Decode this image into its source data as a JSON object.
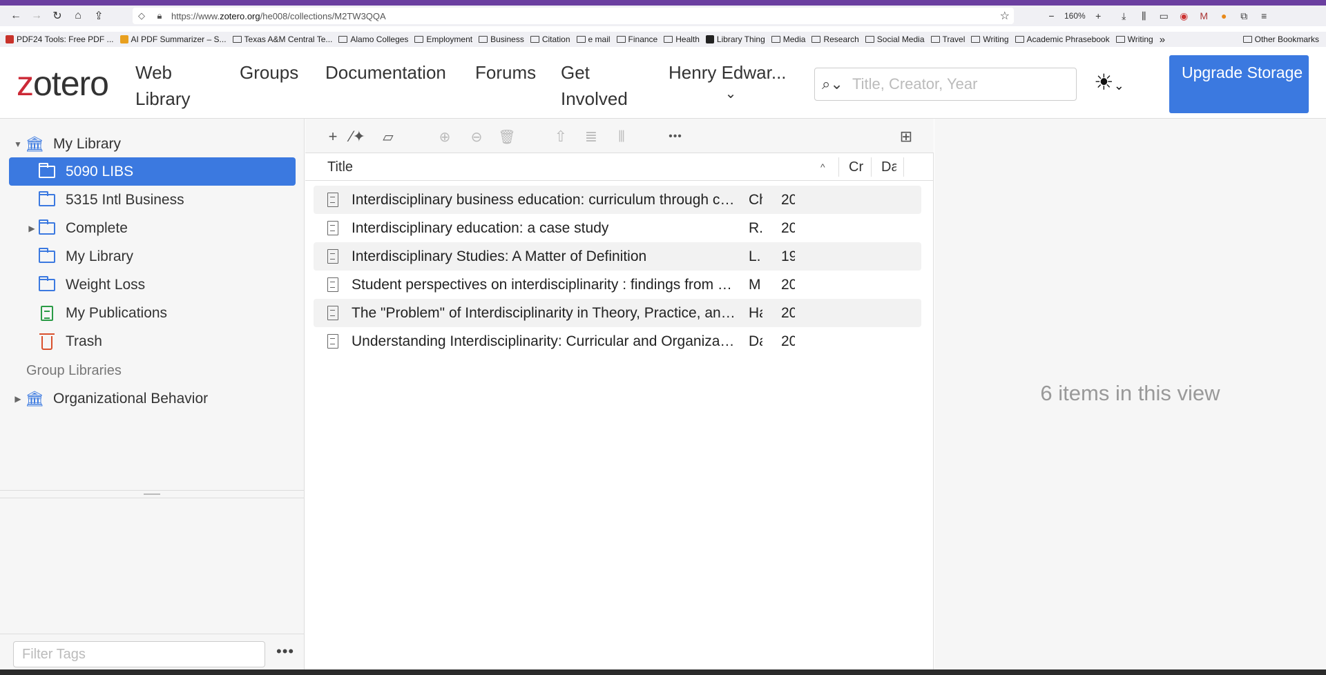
{
  "browser": {
    "url_prefix": "https://www.",
    "url_domain": "zotero.org",
    "url_path": "/he008/collections/M2TW3QQA",
    "zoom": "160%",
    "bookmarks": [
      {
        "label": "PDF24 Tools: Free PDF ...",
        "type": "site",
        "color": "#c8322a"
      },
      {
        "label": "AI PDF Summarizer – S...",
        "type": "site",
        "color": "#e8a020"
      },
      {
        "label": "Texas A&M Central Te...",
        "type": "folder"
      },
      {
        "label": "Alamo Colleges",
        "type": "folder"
      },
      {
        "label": "Employment",
        "type": "folder"
      },
      {
        "label": "Business",
        "type": "folder"
      },
      {
        "label": "Citation",
        "type": "folder"
      },
      {
        "label": "e mail",
        "type": "folder"
      },
      {
        "label": "Finance",
        "type": "folder"
      },
      {
        "label": "Health",
        "type": "folder"
      },
      {
        "label": "Library Thing",
        "type": "site",
        "color": "#222222"
      },
      {
        "label": "Media",
        "type": "folder"
      },
      {
        "label": "Research",
        "type": "folder"
      },
      {
        "label": "Social Media",
        "type": "folder"
      },
      {
        "label": "Travel",
        "type": "folder"
      },
      {
        "label": "Writing",
        "type": "folder"
      },
      {
        "label": "Academic Phrasebook",
        "type": "folder"
      },
      {
        "label": "Writing",
        "type": "folder"
      }
    ],
    "other_bookmarks": "Other Bookmarks"
  },
  "header": {
    "logo_z": "z",
    "logo_rest": "otero",
    "web_library": "Web Library",
    "nav": [
      "Groups",
      "Documentation",
      "Forums",
      "Get Involved"
    ],
    "user": "Henry Edwar...",
    "search_placeholder": "Title, Creator, Year",
    "upgrade": "Upgrade Storage"
  },
  "sidebar": {
    "my_library": "My Library",
    "collections": [
      "5090 LIBS",
      "5315 Intl Business",
      "Complete",
      "My Library",
      "Weight Loss"
    ],
    "my_publications": "My Publications",
    "trash": "Trash",
    "group_libraries_heading": "Group Libraries",
    "groups": [
      "Organizational Behavior"
    ],
    "tag_filter_placeholder": "Filter Tags"
  },
  "items": {
    "columns": {
      "title": "Title",
      "creator": "Cr",
      "date": "Da"
    },
    "rows": [
      {
        "title": "Interdisciplinary business education: curriculum through collaboration",
        "creator": "Ch",
        "date": "20"
      },
      {
        "title": "Interdisciplinary education: a case study",
        "creator": "R.",
        "date": "20"
      },
      {
        "title": "Interdisciplinary Studies: A Matter of Definition",
        "creator": "L.",
        "date": "19"
      },
      {
        "title": "Student perspectives on interdisciplinarity : findings from an interdiscipli...",
        "creator": "M",
        "date": "20"
      },
      {
        "title": "The \"Problem\" of Interdisciplinarity in Theory, Practice, and History",
        "creator": "Ha",
        "date": "20"
      },
      {
        "title": "Understanding Interdisciplinarity: Curricular and Organizational Features...",
        "creator": "Da",
        "date": "20"
      }
    ]
  },
  "details": {
    "count_text": "6 items in this view"
  }
}
